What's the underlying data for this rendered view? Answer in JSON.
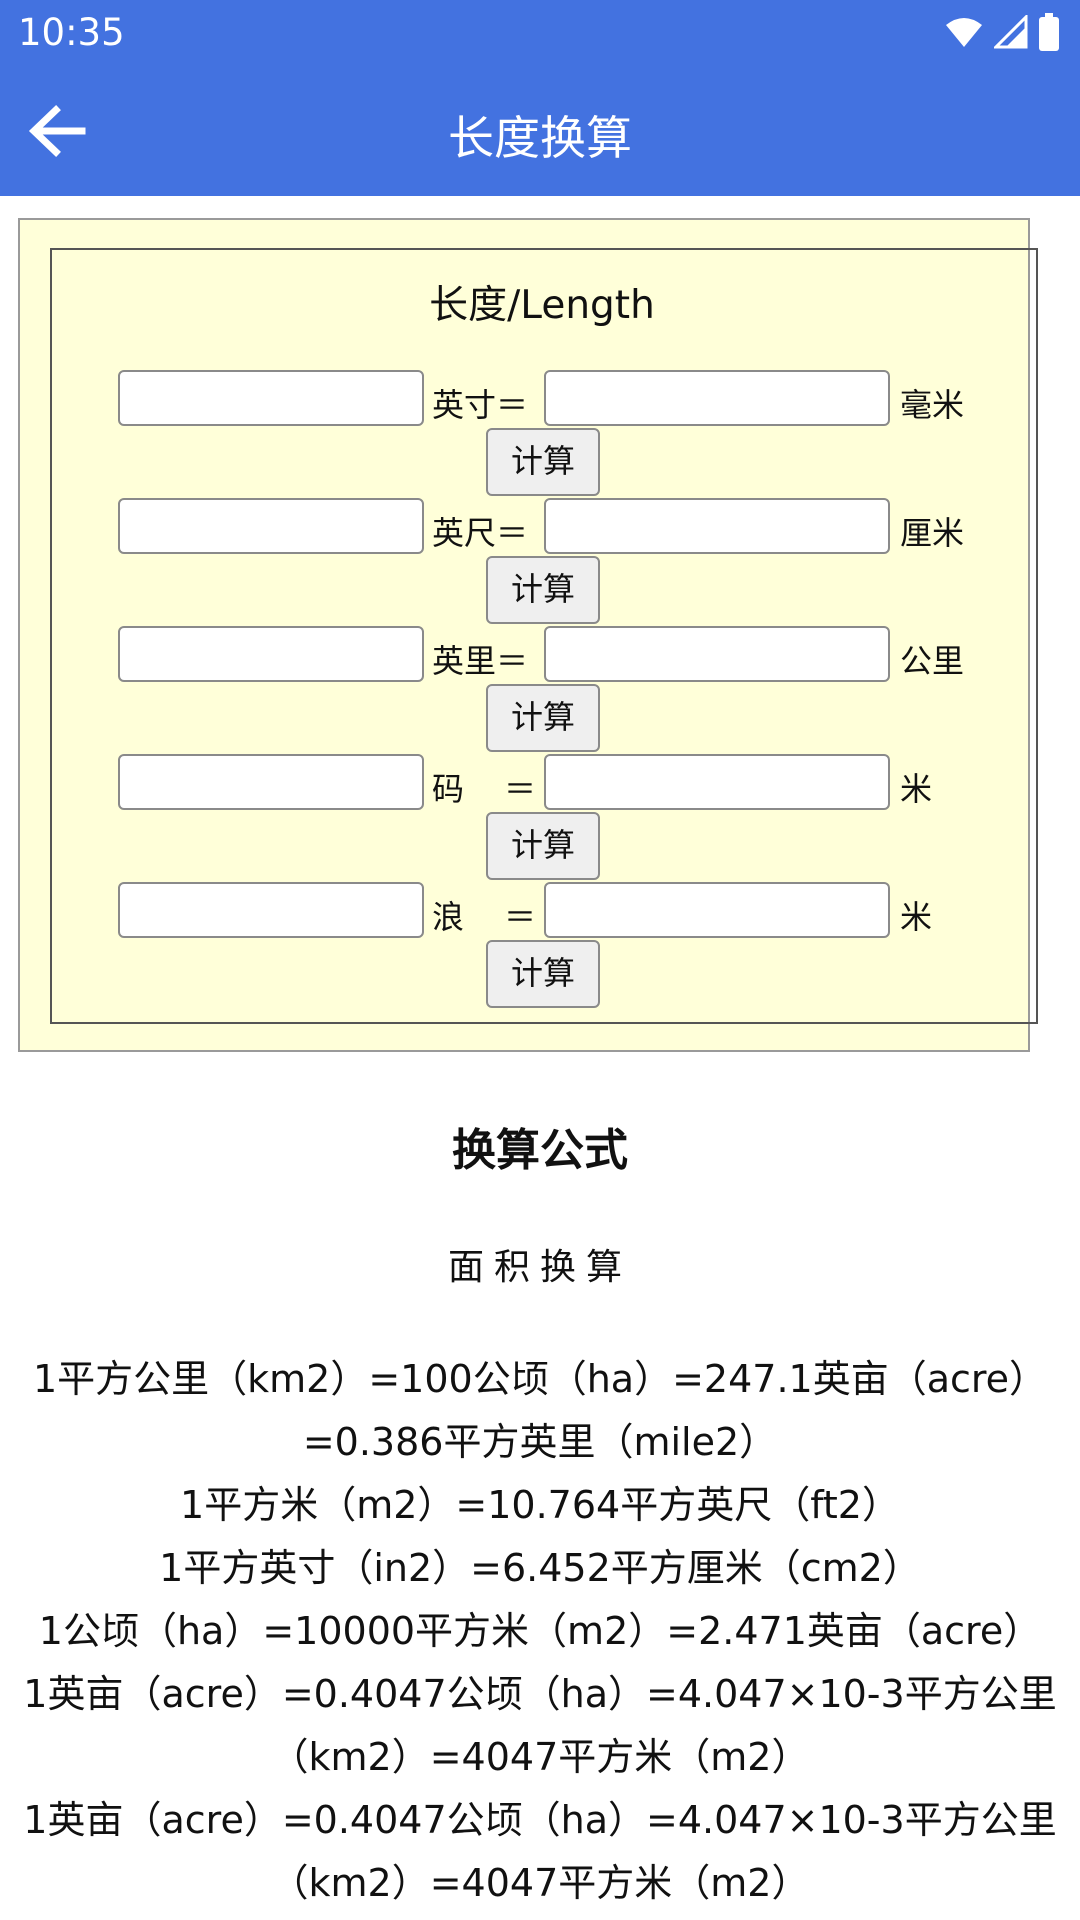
{
  "status": {
    "time": "10:35",
    "icons": [
      "wifi-icon",
      "signal-icon",
      "battery-icon"
    ]
  },
  "appbar": {
    "title": "长度换算",
    "back_icon": "arrow-left-icon"
  },
  "form": {
    "title": "长度/Length",
    "rows": [
      {
        "left_unit": "英寸＝",
        "right_unit": "毫米",
        "left_value": "",
        "right_value": "",
        "button": "计算"
      },
      {
        "left_unit": "英尺＝",
        "right_unit": "厘米",
        "left_value": "",
        "right_value": "",
        "button": "计算"
      },
      {
        "left_unit": "英里＝",
        "right_unit": "公里",
        "left_value": "",
        "right_value": "",
        "button": "计算"
      },
      {
        "left_unit": "码",
        "right_unit": "米",
        "left_value": "",
        "right_value": "",
        "button": "计算"
      },
      {
        "left_unit": "浪",
        "right_unit": "米",
        "left_value": "",
        "right_value": "",
        "button": "计算"
      }
    ],
    "equals": "＝"
  },
  "formulas": {
    "title": "换算公式",
    "subtitle": "面积换算",
    "lines": [
      "1平方公里（km2）=100公顷（ha）=247.1英亩（acre）=0.386平方英里（mile2）",
      "1平方米（m2）=10.764平方英尺（ft2）",
      "1平方英寸（in2）=6.452平方厘米（cm2）",
      "1公顷（ha）=10000平方米（m2）=2.471英亩（acre）",
      "1英亩（acre）=0.4047公顷（ha）=4.047×10-3平方公里（km2）=4047平方米（m2）",
      "1英亩（acre）=0.4047公顷（ha）=4.047×10-3平方公里（km2）=4047平方米（m2）"
    ]
  },
  "colors": {
    "appbar": "#4372e0",
    "panel": "#ffffd9"
  }
}
